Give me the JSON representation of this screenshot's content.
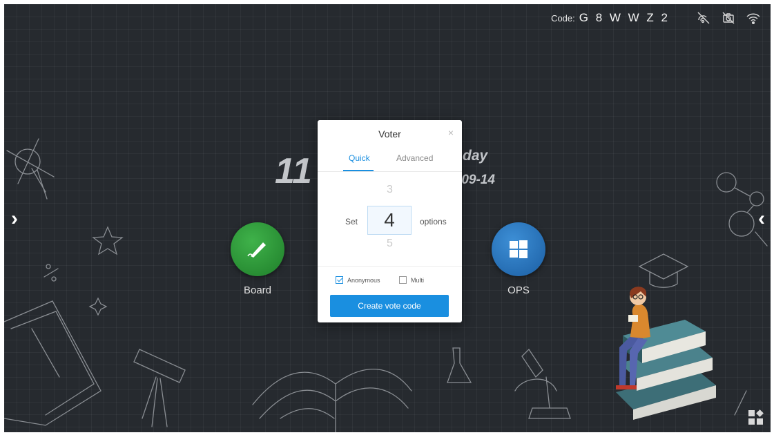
{
  "status_bar": {
    "code_label": "Code:",
    "code_value": "G 8 W W Z 2",
    "icons": [
      "screen-share-off-icon",
      "camera-off-icon",
      "wifi-icon"
    ]
  },
  "clock": {
    "time_partial": "11",
    "day_partial": "day",
    "date_partial": "-09-14"
  },
  "nav": {
    "left_arrow": "›",
    "right_arrow": "‹"
  },
  "apps": [
    {
      "label": "Board",
      "icon": "pen-icon",
      "color": "#2e9a3a"
    },
    {
      "label": "OPS",
      "icon": "windows-icon",
      "color": "#2a78c4"
    }
  ],
  "dialog": {
    "title": "Voter",
    "close": "×",
    "tabs": [
      {
        "label": "Quick",
        "active": true
      },
      {
        "label": "Advanced",
        "active": false
      }
    ],
    "picker": {
      "prev": "3",
      "current": "4",
      "next": "5",
      "prefix": "Set",
      "suffix": "options"
    },
    "anonymous": {
      "label": "Anonymous",
      "checked": true
    },
    "multi": {
      "label": "Multi",
      "checked": false
    },
    "create_button": "Create vote code"
  },
  "colors": {
    "accent": "#1a8fe0",
    "background": "#262a2f"
  }
}
